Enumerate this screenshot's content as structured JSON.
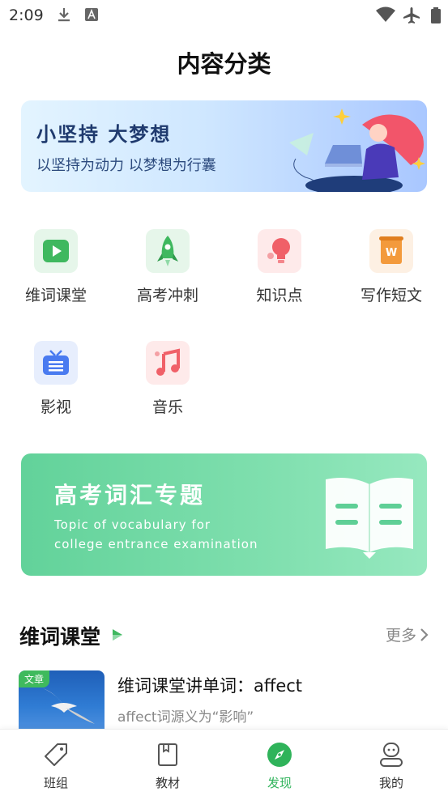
{
  "status_bar": {
    "time": "2:09",
    "icons": [
      "download-icon",
      "font-icon",
      "wifi-icon",
      "airplane-icon",
      "battery-icon"
    ]
  },
  "page": {
    "title": "内容分类"
  },
  "banner": {
    "title": "小坚持 大梦想",
    "subtitle": "以坚持为动力 以梦想为行囊"
  },
  "categories": [
    {
      "label": "维词课堂",
      "icon": "video-play-icon",
      "color": "#3fb85f",
      "bg": "#e6f6ea"
    },
    {
      "label": "高考冲刺",
      "icon": "rocket-icon",
      "color": "#3fb85f",
      "bg": "#e6f6ea"
    },
    {
      "label": "知识点",
      "icon": "lightbulb-icon",
      "color": "#f06068",
      "bg": "#feeaea"
    },
    {
      "label": "写作短文",
      "icon": "scroll-w-icon",
      "color": "#f39a3c",
      "bg": "#fdf0e3"
    },
    {
      "label": "影视",
      "icon": "tv-icon",
      "color": "#4a7bf0",
      "bg": "#e7eefd"
    },
    {
      "label": "音乐",
      "icon": "music-note-icon",
      "color": "#f06068",
      "bg": "#feeaea"
    }
  ],
  "vocab_card": {
    "title": "高考词汇专题",
    "subtitle_line1": "Topic of vocabulary for",
    "subtitle_line2": "college entrance examination"
  },
  "section": {
    "title": "维词课堂",
    "more": "更多"
  },
  "article": {
    "tag": "文章",
    "title": "维词课堂讲单词：affect",
    "description": "affect词源义为“影响”"
  },
  "bottom_nav": [
    {
      "label": "班组",
      "icon": "tag-icon",
      "active": false
    },
    {
      "label": "教材",
      "icon": "book-icon",
      "active": false
    },
    {
      "label": "发现",
      "icon": "compass-icon",
      "active": true
    },
    {
      "label": "我的",
      "icon": "profile-icon",
      "active": false
    }
  ],
  "colors": {
    "accent": "#2fb35a",
    "vocab_card": "#62d29a",
    "banner_text": "#1f3a6e"
  }
}
